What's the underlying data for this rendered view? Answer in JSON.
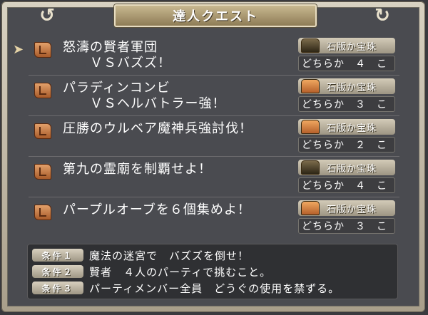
{
  "title": "達人クエスト",
  "quests": [
    {
      "name": "怒濤の賢者軍団\n　　ＶＳバズズ！",
      "reward_item": "石版か宝珠",
      "reward_count": "どちらか　４　こ",
      "chest": "dark"
    },
    {
      "name": "パラディンコンビ\n　　ＶＳヘルバトラー強！",
      "reward_item": "石版か宝珠",
      "reward_count": "どちらか　３　こ",
      "chest": "gold"
    },
    {
      "name": "圧勝のウルベア魔神兵強討伐！",
      "reward_item": "石版か宝珠",
      "reward_count": "どちらか　２　こ",
      "chest": "gold"
    },
    {
      "name": "第九の霊廟を制覇せよ！",
      "reward_item": "石版か宝珠",
      "reward_count": "どちらか　４　こ",
      "chest": "dark"
    },
    {
      "name": "パープルオーブを６個集めよ！",
      "reward_item": "石版か宝珠",
      "reward_count": "どちらか　３　こ",
      "chest": "gold"
    }
  ],
  "conditions": [
    {
      "badge": "条件１",
      "text": "魔法の迷宮で　バズズを倒せ！"
    },
    {
      "badge": "条件２",
      "text": "賢者　４人のパーティで挑むこと。"
    },
    {
      "badge": "条件３",
      "text": "パーティメンバー全員　どうぐの使用を禁ずる。"
    }
  ]
}
